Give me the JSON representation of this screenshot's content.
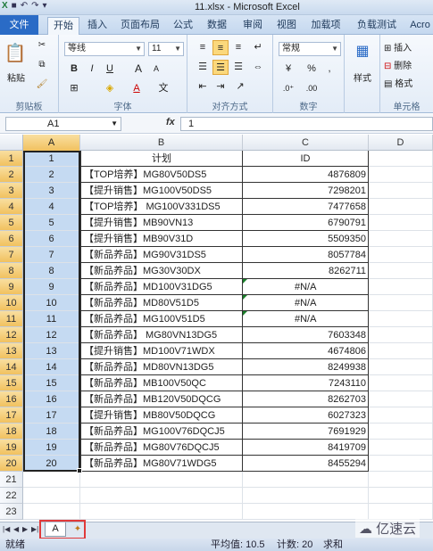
{
  "window": {
    "title": "11.xlsx - Microsoft Excel",
    "qat": [
      "save-icon",
      "undo-icon",
      "redo-icon",
      "customize-icon"
    ]
  },
  "tabs": [
    "文件",
    "开始",
    "插入",
    "页面布局",
    "公式",
    "数据",
    "审阅",
    "视图",
    "加载项",
    "负载测试",
    "Acro"
  ],
  "ribbon": {
    "clipboard": {
      "paste": "粘贴",
      "label": "剪贴板"
    },
    "font": {
      "name": "等线",
      "size": "11",
      "label": "字体",
      "bold": "B",
      "italic": "I",
      "underline": "U",
      "grow": "A",
      "shrink": "A",
      "color": "A"
    },
    "alignment": {
      "label": "对齐方式"
    },
    "number": {
      "format": "常规",
      "percent": "%",
      "comma": ",",
      "label": "数字"
    },
    "styles": {
      "label": "样式"
    },
    "cells": {
      "insert": "插入",
      "delete": "删除",
      "format": "格式",
      "label": "单元格"
    }
  },
  "formula_bar": {
    "name_box": "A1",
    "fx": "fx",
    "value": "1"
  },
  "columns": [
    "A",
    "B",
    "C",
    "D"
  ],
  "rows": [
    {
      "n": "1",
      "a": "1",
      "b": "计划",
      "c": "ID",
      "na": false,
      "header": true
    },
    {
      "n": "2",
      "a": "2",
      "b": "【TOP培养】MG80V50DS5",
      "c": "4876809",
      "na": false
    },
    {
      "n": "3",
      "a": "3",
      "b": "【提升销售】MG100V50DS5",
      "c": "7298201",
      "na": false
    },
    {
      "n": "4",
      "a": "4",
      "b": "【TOP培养】 MG100V331DS5",
      "c": "7477658",
      "na": false
    },
    {
      "n": "5",
      "a": "5",
      "b": "【提升销售】MB90VN13",
      "c": "6790791",
      "na": false
    },
    {
      "n": "6",
      "a": "6",
      "b": "【提升销售】MB90V31D",
      "c": "5509350",
      "na": false
    },
    {
      "n": "7",
      "a": "7",
      "b": "【新品养品】MG90V31DS5",
      "c": "8057784",
      "na": false
    },
    {
      "n": "8",
      "a": "8",
      "b": "【新品养品】MG30V30DX",
      "c": "8262711",
      "na": false
    },
    {
      "n": "9",
      "a": "9",
      "b": "【新品养品】MD100V31DG5",
      "c": "#N/A",
      "na": true
    },
    {
      "n": "10",
      "a": "10",
      "b": "【新品养品】MD80V51D5",
      "c": "#N/A",
      "na": true
    },
    {
      "n": "11",
      "a": "11",
      "b": "【新品养品】MG100V51D5",
      "c": "#N/A",
      "na": true
    },
    {
      "n": "12",
      "a": "12",
      "b": "【新品养品】  MG80VN13DG5",
      "c": "7603348",
      "na": false
    },
    {
      "n": "13",
      "a": "13",
      "b": "【提升销售】MD100V71WDX",
      "c": "4674806",
      "na": false
    },
    {
      "n": "14",
      "a": "14",
      "b": "【新品养品】MD80VN13DG5",
      "c": "8249938",
      "na": false
    },
    {
      "n": "15",
      "a": "15",
      "b": "【新品养品】MB100V50QC",
      "c": "7243110",
      "na": false
    },
    {
      "n": "16",
      "a": "16",
      "b": "【新品养品】MB120V50DQCG",
      "c": "8262703",
      "na": false
    },
    {
      "n": "17",
      "a": "17",
      "b": "【提升销售】MB80V50DQCG",
      "c": "6027323",
      "na": false
    },
    {
      "n": "18",
      "a": "18",
      "b": "【新品养品】MG100V76DQCJ5",
      "c": "7691929",
      "na": false
    },
    {
      "n": "19",
      "a": "19",
      "b": "【新品养品】MG80V76DQCJ5",
      "c": "8419709",
      "na": false
    },
    {
      "n": "20",
      "a": "20",
      "b": "【新品养品】MG80V71WDG5",
      "c": "8455294",
      "na": false
    },
    {
      "n": "21",
      "a": "",
      "b": "",
      "c": "",
      "na": false,
      "empty": true
    },
    {
      "n": "22",
      "a": "",
      "b": "",
      "c": "",
      "na": false,
      "empty": true
    },
    {
      "n": "23",
      "a": "",
      "b": "",
      "c": "",
      "na": false,
      "empty": true
    }
  ],
  "sheet_tabs": {
    "active": "A"
  },
  "status": {
    "left": "就绪",
    "average": "平均值: 10.5",
    "count": "计数: 20",
    "sum": "求和"
  },
  "watermark": "亿速云",
  "colors": {
    "accent": "#2a6bc6",
    "selection": "#c5daf2",
    "header_active": "#f1c15f",
    "highlight": "#e03a3a"
  }
}
